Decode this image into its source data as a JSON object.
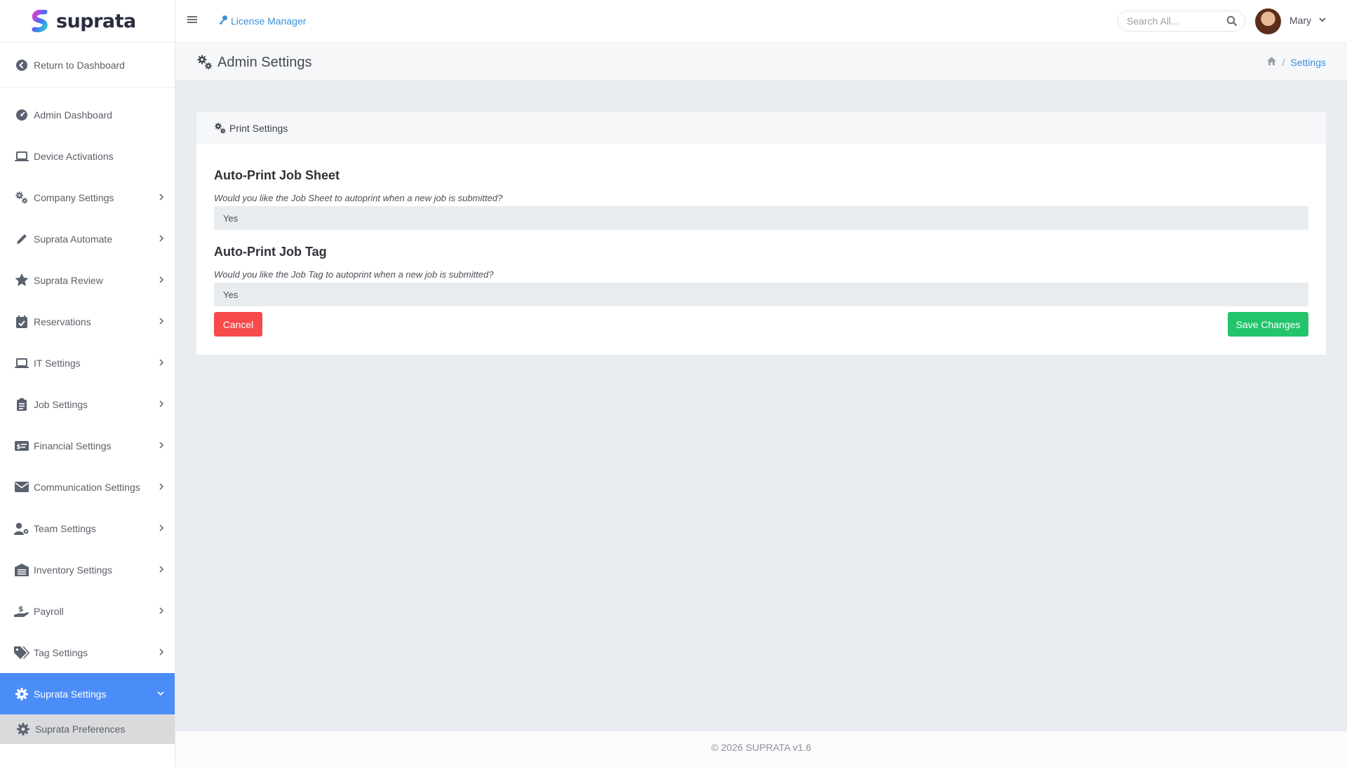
{
  "brand": {
    "name": "suprata",
    "accent": "#4b8df8",
    "logo_colors": [
      "#e03ccf",
      "#4b6cf6",
      "#2ec4d6"
    ]
  },
  "sidebar": {
    "return_label": "Return to Dashboard",
    "items": [
      {
        "label": "Admin Dashboard",
        "icon": "gauge-icon",
        "chevron": false
      },
      {
        "label": "Device Activations",
        "icon": "laptop-icon",
        "chevron": false
      },
      {
        "label": "Company Settings",
        "icon": "cogs-icon",
        "chevron": true
      },
      {
        "label": "Suprata Automate",
        "icon": "pencil-icon",
        "chevron": true
      },
      {
        "label": "Suprata Review",
        "icon": "star-icon",
        "chevron": true
      },
      {
        "label": "Reservations",
        "icon": "calendar-check-icon",
        "chevron": true
      },
      {
        "label": "IT Settings",
        "icon": "laptop-icon",
        "chevron": true
      },
      {
        "label": "Job Settings",
        "icon": "clipboard-icon",
        "chevron": true
      },
      {
        "label": "Financial Settings",
        "icon": "money-card-icon",
        "chevron": true
      },
      {
        "label": "Communication Settings",
        "icon": "envelope-icon",
        "chevron": true
      },
      {
        "label": "Team Settings",
        "icon": "user-cog-icon",
        "chevron": true
      },
      {
        "label": "Inventory Settings",
        "icon": "warehouse-icon",
        "chevron": true
      },
      {
        "label": "Payroll",
        "icon": "hand-dollar-icon",
        "chevron": true
      },
      {
        "label": "Tag Settings",
        "icon": "tags-icon",
        "chevron": true
      }
    ],
    "active": {
      "label": "Suprata Settings",
      "icon": "gear-icon"
    },
    "sub": {
      "label": "Suprata Preferences",
      "icon": "gear-icon"
    }
  },
  "topbar": {
    "license_label": "License Manager",
    "search_placeholder": "Search All...",
    "user_name": "Mary"
  },
  "page": {
    "title": "Admin Settings",
    "breadcrumb_current": "Settings",
    "breadcrumb_sep": "/"
  },
  "card": {
    "title": "Print Settings",
    "settings": [
      {
        "title": "Auto-Print Job Sheet",
        "description": "Would you like the Job Sheet to autoprint when a new job is submitted?",
        "value": "Yes"
      },
      {
        "title": "Auto-Print Job Tag",
        "description": "Would you like the Job Tag to autoprint when a new job is submitted?",
        "value": "Yes"
      }
    ],
    "cancel_label": "Cancel",
    "save_label": "Save Changes"
  },
  "footer": {
    "text": "© 2026 SUPRATA v1.6"
  }
}
